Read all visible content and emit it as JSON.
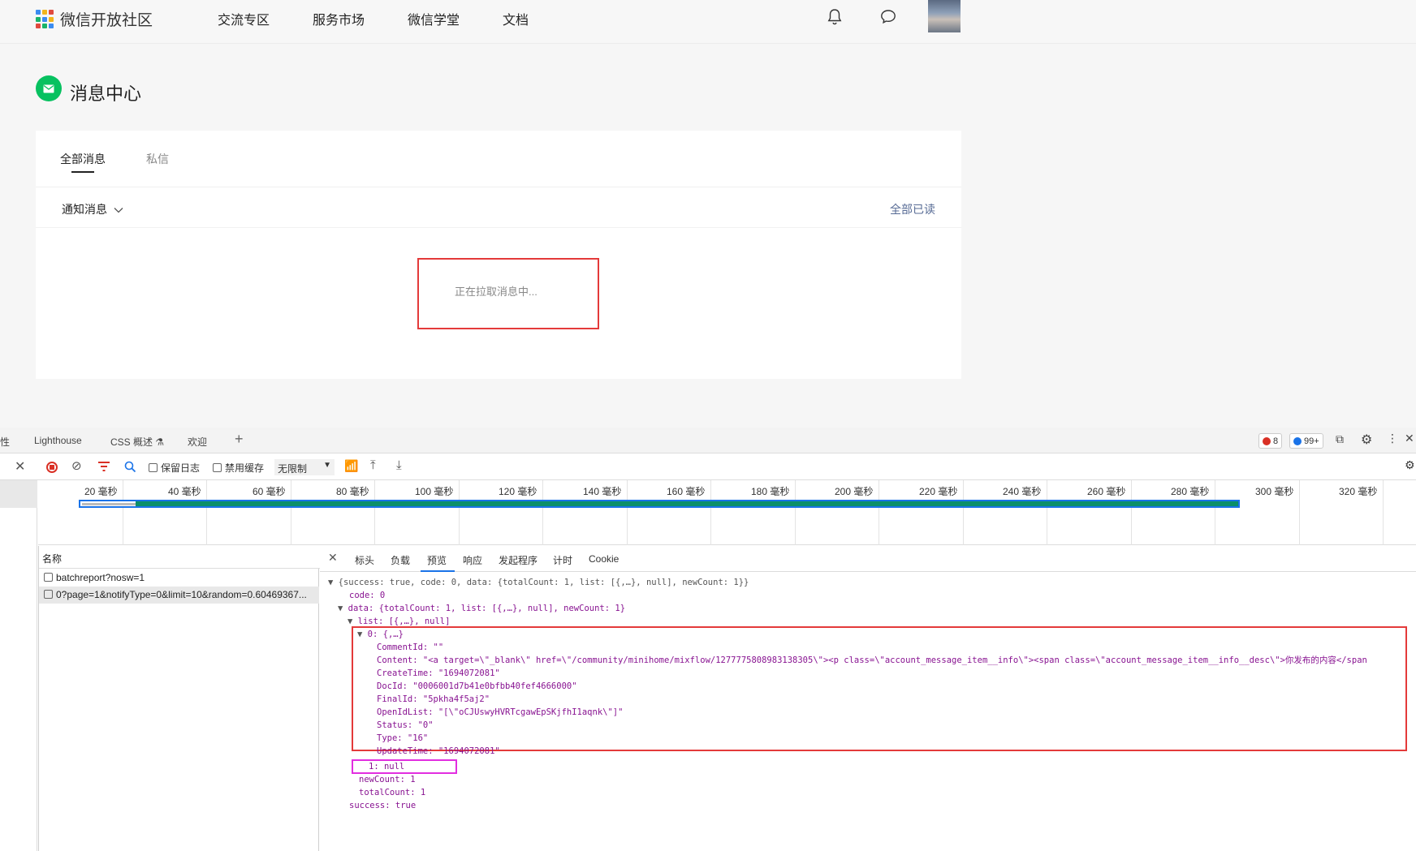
{
  "nav": {
    "brand": "微信开放社区",
    "links": [
      "交流专区",
      "服务市场",
      "微信学堂",
      "文档"
    ]
  },
  "page": {
    "title": "消息中心",
    "tabs": [
      "全部消息",
      "私信"
    ],
    "filter_label": "通知消息",
    "read_all": "全部已读",
    "loading": "正在拉取消息中..."
  },
  "devtools": {
    "top_tabs": [
      "性",
      "Lighthouse",
      "CSS 概述",
      "欢迎"
    ],
    "errors": "8",
    "messages": "99+",
    "toolbar": {
      "preserve_log": "保留日志",
      "disable_cache": "禁用缓存",
      "throttle": "无限制"
    },
    "timeline_ticks": [
      "20 毫秒",
      "40 毫秒",
      "60 毫秒",
      "80 毫秒",
      "100 毫秒",
      "120 毫秒",
      "140 毫秒",
      "160 毫秒",
      "180 毫秒",
      "200 毫秒",
      "220 毫秒",
      "240 毫秒",
      "260 毫秒",
      "280 毫秒",
      "300 毫秒",
      "320 毫秒"
    ],
    "name_header": "名称",
    "requests": [
      "batchreport?nosw=1",
      "0?page=1&notifyType=0&limit=10&random=0.60469367..."
    ],
    "preview_tabs": [
      "标头",
      "负载",
      "预览",
      "响应",
      "发起程序",
      "计时",
      "Cookie"
    ],
    "json_lines": [
      "{success: true, code: 0, data: {totalCount: 1, list: [{,…}, null], newCount: 1}}",
      "code: 0",
      "data: {totalCount: 1, list: [{,…}, null], newCount: 1}",
      "list: [{,…}, null]",
      "0: {,…}",
      "CommentId: \"\"",
      "Content: \"<a target=\\\"_blank\\\" href=\\\"/community/minihome/mixflow/1277775808983138305\\\"><p class=\\\"account_message_item__info\\\"><span class=\\\"account_message_item__info__desc\\\">你发布的内容</span",
      "CreateTime: \"1694072081\"",
      "DocId: \"0006001d7b41e0bfbb40fef4666000\"",
      "FinalId: \"5pkha4f5aj2\"",
      "OpenIdList: \"[\\\"oCJUswyHVRTcgawEpSKjfhI1aqnk\\\"]\"",
      "Status: \"0\"",
      "Type: \"16\"",
      "UpdateTime: \"1694072081\"",
      "1: null",
      "newCount: 1",
      "totalCount: 1",
      "success: true"
    ]
  }
}
